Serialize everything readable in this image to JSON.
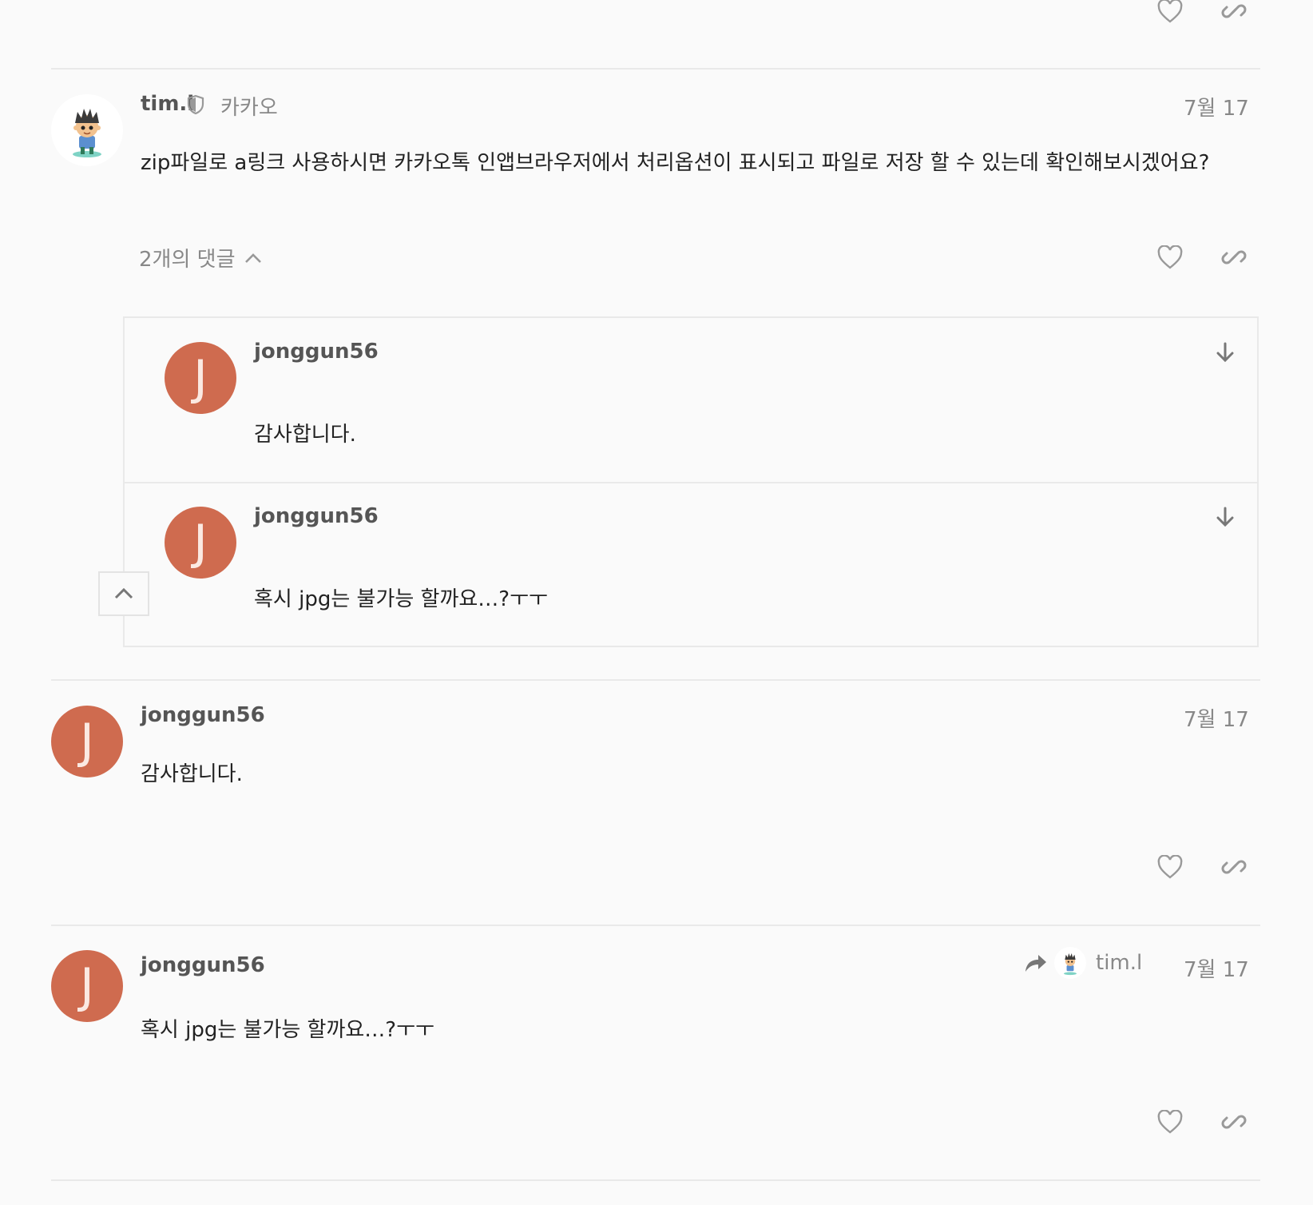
{
  "posts": [
    {
      "author": "tim.l",
      "group": "카카오",
      "date": "7월 17",
      "body": "zip파일로 a링크 사용하시면 카카오톡 인앱브라우저에서 처리옵션이 표시되고 파일로 저장 할 수 있는데 확인해보시겠어요?",
      "replies_toggle": "2개의 댓글",
      "replies": [
        {
          "author": "jonggun56",
          "avatar_letter": "J",
          "body": "감사합니다."
        },
        {
          "author": "jonggun56",
          "avatar_letter": "J",
          "body": "혹시 jpg는 불가능 할까요…?ㅜㅜ"
        }
      ]
    },
    {
      "author": "jonggun56",
      "avatar_letter": "J",
      "date": "7월 17",
      "body": "감사합니다."
    },
    {
      "author": "jonggun56",
      "avatar_letter": "J",
      "date": "7월 17",
      "reply_to": "tim.l",
      "body": "혹시 jpg는 불가능 할까요…?ㅜㅜ"
    }
  ],
  "icons": {
    "like": "heart-outline-icon",
    "share": "link-icon",
    "moderator": "shield-icon",
    "expand_reply": "arrow-down-icon",
    "collapse": "chevron-up-icon",
    "reply_to": "share-arrow-icon"
  },
  "colors": {
    "avatar_bg": "#cf6b4f",
    "background": "#fafafa",
    "divider": "#e9e9e9",
    "muted_text": "#888888"
  }
}
